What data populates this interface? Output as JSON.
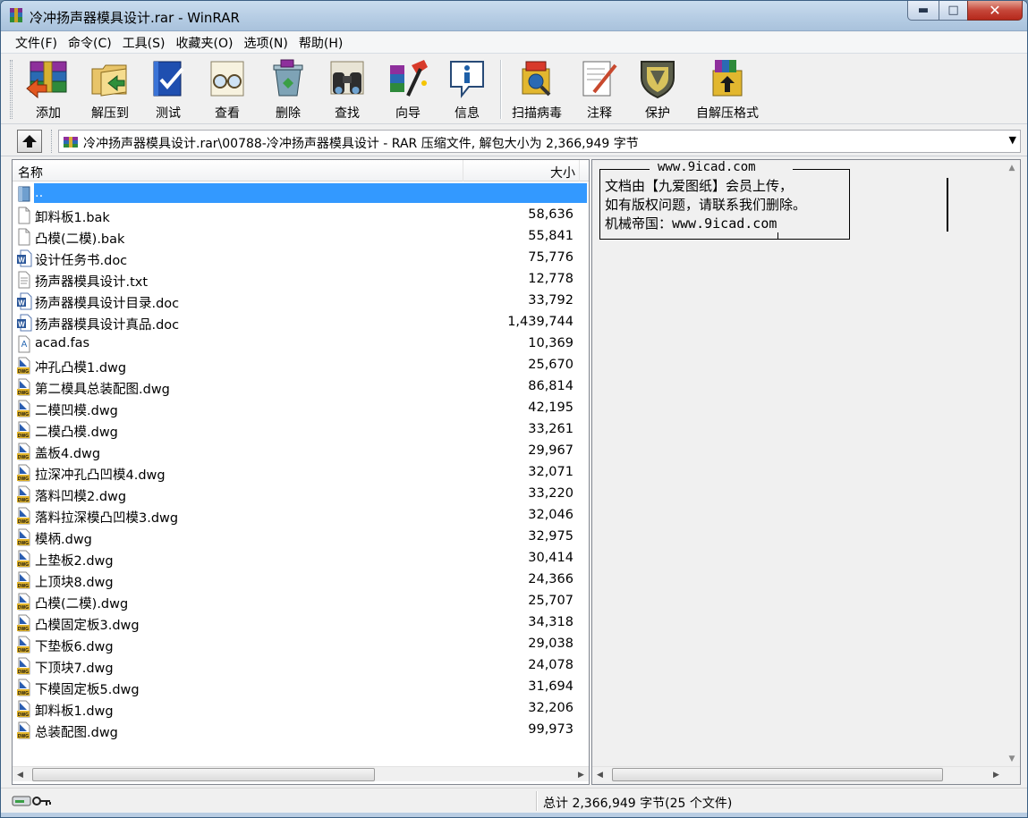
{
  "window": {
    "title": "冷冲扬声器模具设计.rar - WinRAR",
    "controls": {
      "minimize": "▬",
      "maximize": "□",
      "close": "✕"
    }
  },
  "menu": [
    "文件(F)",
    "命令(C)",
    "工具(S)",
    "收藏夹(O)",
    "选项(N)",
    "帮助(H)"
  ],
  "toolbar": [
    {
      "label": "添加",
      "icon": "add-books-icon"
    },
    {
      "label": "解压到",
      "icon": "extract-folder-icon"
    },
    {
      "label": "测试",
      "icon": "test-book-icon"
    },
    {
      "label": "查看",
      "icon": "view-glasses-icon"
    },
    {
      "label": "删除",
      "icon": "delete-bin-icon"
    },
    {
      "label": "查找",
      "icon": "find-binoculars-icon"
    },
    {
      "label": "向导",
      "icon": "wizard-wand-icon"
    },
    {
      "label": "信息",
      "icon": "info-icon"
    },
    {
      "label": "扫描病毒",
      "icon": "scan-virus-icon"
    },
    {
      "label": "注释",
      "icon": "comment-note-icon"
    },
    {
      "label": "保护",
      "icon": "protect-shield-icon"
    },
    {
      "label": "自解压格式",
      "icon": "sfx-box-icon"
    }
  ],
  "address": {
    "path": "冷冲扬声器模具设计.rar\\00788-冷冲扬声器模具设计 - RAR 压缩文件, 解包大小为 2,366,949 字节",
    "dropdown": "▼"
  },
  "columns": {
    "name": "名称",
    "size": "大小"
  },
  "files": [
    {
      "name": "..",
      "size": "",
      "type": "parent",
      "selected": true
    },
    {
      "name": "卸料板1.bak",
      "size": "58,636",
      "type": "blank"
    },
    {
      "name": "凸模(二模).bak",
      "size": "55,841",
      "type": "blank"
    },
    {
      "name": "设计任务书.doc",
      "size": "75,776",
      "type": "doc"
    },
    {
      "name": "扬声器模具设计.txt",
      "size": "12,778",
      "type": "txt"
    },
    {
      "name": "扬声器模具设计目录.doc",
      "size": "33,792",
      "type": "doc"
    },
    {
      "name": "扬声器模具设计真品.doc",
      "size": "1,439,744",
      "type": "doc"
    },
    {
      "name": "acad.fas",
      "size": "10,369",
      "type": "fas"
    },
    {
      "name": "冲孔凸模1.dwg",
      "size": "25,670",
      "type": "dwg"
    },
    {
      "name": "第二模具总装配图.dwg",
      "size": "86,814",
      "type": "dwg"
    },
    {
      "name": "二模凹模.dwg",
      "size": "42,195",
      "type": "dwg"
    },
    {
      "name": "二模凸模.dwg",
      "size": "33,261",
      "type": "dwg"
    },
    {
      "name": "盖板4.dwg",
      "size": "29,967",
      "type": "dwg"
    },
    {
      "name": "拉深冲孔凸凹模4.dwg",
      "size": "32,071",
      "type": "dwg"
    },
    {
      "name": "落料凹模2.dwg",
      "size": "33,220",
      "type": "dwg"
    },
    {
      "name": "落料拉深模凸凹模3.dwg",
      "size": "32,046",
      "type": "dwg"
    },
    {
      "name": "模柄.dwg",
      "size": "32,975",
      "type": "dwg"
    },
    {
      "name": "上垫板2.dwg",
      "size": "30,414",
      "type": "dwg"
    },
    {
      "name": "上顶块8.dwg",
      "size": "24,366",
      "type": "dwg"
    },
    {
      "name": "凸模(二模).dwg",
      "size": "25,707",
      "type": "dwg"
    },
    {
      "name": "凸模固定板3.dwg",
      "size": "34,318",
      "type": "dwg"
    },
    {
      "name": "下垫板6.dwg",
      "size": "29,038",
      "type": "dwg"
    },
    {
      "name": "下顶块7.dwg",
      "size": "24,078",
      "type": "dwg"
    },
    {
      "name": "下模固定板5.dwg",
      "size": "31,694",
      "type": "dwg"
    },
    {
      "name": "卸料板1.dwg",
      "size": "32,206",
      "type": "dwg"
    },
    {
      "name": "总装配图.dwg",
      "size": "99,973",
      "type": "dwg"
    }
  ],
  "comment": {
    "header": "www.9icad.com",
    "lines": [
      "文档由【九爱图纸】会员上传，",
      "如有版权问题，请联系我们删除。",
      "机械帝国：www.9icad.com"
    ]
  },
  "scroll": {
    "left": "◀",
    "right": "▶",
    "up": "▲",
    "down": "▼",
    "grip": "|||"
  },
  "status": {
    "summary": "总计 2,366,949 字节(25 个文件)"
  }
}
